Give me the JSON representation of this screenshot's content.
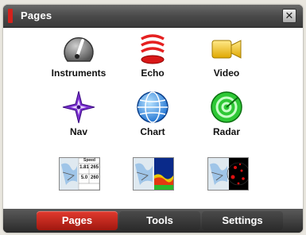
{
  "window": {
    "title": "Pages",
    "close_glyph": "✕"
  },
  "apps": [
    {
      "label": "Instruments",
      "icon": "instruments-gauge-icon"
    },
    {
      "label": "Echo",
      "icon": "echo-sonar-icon"
    },
    {
      "label": "Video",
      "icon": "video-camera-icon"
    },
    {
      "label": "Nav",
      "icon": "nav-compass-icon"
    },
    {
      "label": "Chart",
      "icon": "chart-globe-icon"
    },
    {
      "label": "Radar",
      "icon": "radar-icon"
    }
  ],
  "splits": [
    {
      "kind": "chart-instruments",
      "instrument_header": "Speed",
      "readings": [
        [
          "1.81",
          "265"
        ],
        [
          "5.0",
          "260"
        ]
      ]
    },
    {
      "kind": "chart-echo"
    },
    {
      "kind": "chart-radar"
    }
  ],
  "tabs": [
    {
      "label": "Pages",
      "active": true
    },
    {
      "label": "Tools",
      "active": false
    },
    {
      "label": "Settings",
      "active": false
    }
  ],
  "colors": {
    "accent": "#d4221c",
    "titlebar": "#4a4a4a"
  }
}
